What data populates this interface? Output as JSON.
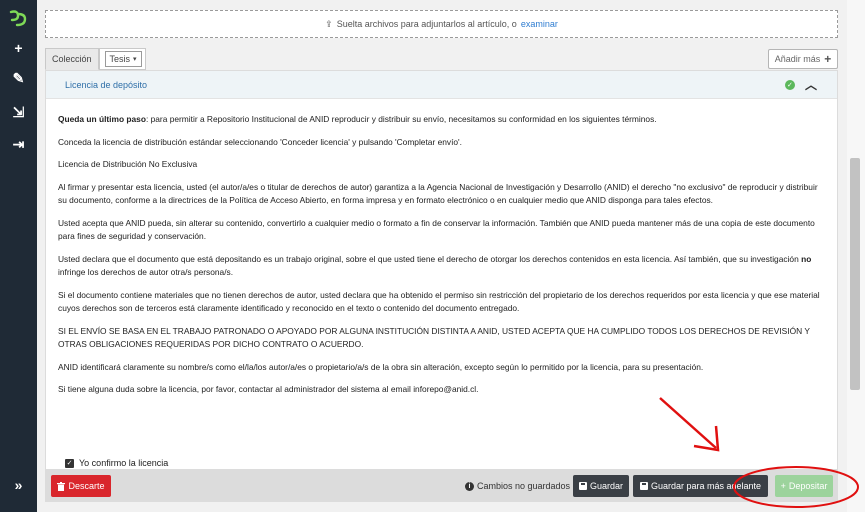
{
  "sidebar": {
    "logo": "dspace-logo",
    "items": [
      {
        "icon": "plus-icon",
        "glyph": "+"
      },
      {
        "icon": "pencil-icon",
        "glyph": "✎"
      },
      {
        "icon": "import-icon",
        "glyph": "⇲"
      },
      {
        "icon": "export-icon",
        "glyph": "⇥"
      }
    ],
    "expand_glyph": "»"
  },
  "dropzone": {
    "text": "Suelta archivos para adjuntarlos al artículo, o",
    "browse": "examinar",
    "upload_glyph": "⇪"
  },
  "tabs": {
    "collection_label": "Colección",
    "type_value": "Tesis",
    "caret": "▾"
  },
  "add_more": {
    "label": "Añadir más",
    "plus": "+"
  },
  "panel": {
    "title": "Licencia de depósito",
    "check_glyph": "✓",
    "chevron": "︿"
  },
  "license": {
    "p1_bold": "Queda un último paso",
    "p1_rest": ": para permitir a Repositorio Institucional de ANID reproducir y distribuir su envío, necesitamos su conformidad en los siguientes términos.",
    "p2": "Conceda la licencia de distribución estándar seleccionando 'Conceder licencia' y pulsando 'Completar envío'.",
    "p3": "Licencia de Distribución No Exclusiva",
    "p4": "Al firmar y presentar esta licencia, usted (el autor/a/es o titular de derechos de autor) garantiza a la Agencia Nacional de Investigación y Desarrollo (ANID) el derecho \"no exclusivo\" de reproducir y distribuir su documento, conforme a la directrices de la Política de Acceso Abierto, en forma impresa y en formato electrónico o en cualquier medio que ANID disponga para tales efectos.",
    "p5": "Usted acepta que ANID pueda, sin alterar su contenido, convertirlo a cualquier medio o formato a fin de conservar la información. También que ANID pueda mantener más de una copia de este documento para fines de seguridad y conservación.",
    "p6_a": "Usted declara que el documento que está depositando es un trabajo original, sobre el que usted tiene el derecho de otorgar los derechos contenidos en esta licencia. Así también, que su investigación ",
    "p6_bold": "no",
    "p6_b": " infringe los derechos de autor otra/s persona/s.",
    "p7": "Si el documento contiene materiales que no tienen derechos de autor, usted declara que ha obtenido el permiso sin restricción del propietario de los derechos requeridos por esta licencia y que ese material cuyos derechos son de terceros está claramente identificado y reconocido en el texto o contenido del documento entregado.",
    "p8": "SI EL ENVÍO SE BASA EN EL TRABAJO PATRONADO O APOYADO POR ALGUNA INSTITUCIÓN DISTINTA A ANID, USTED ACEPTA QUE HA CUMPLIDO TODOS LOS DERECHOS DE REVISIÓN Y OTRAS OBLIGACIONES REQUERIDAS POR DICHO CONTRATO O ACUERDO.",
    "p9": "ANID identificará claramente su nombre/s como el/la/los autor/a/es o propietario/a/s de la obra sin alteración, excepto según lo permitido por la licencia, para su presentación.",
    "p10": "Si tiene alguna duda sobre la licencia, por favor, contactar al administrador del sistema al email inforepo@anid.cl."
  },
  "confirm": {
    "label": "Yo confirmo la licencia",
    "checked": true,
    "check_glyph": "✓"
  },
  "footer": {
    "discard_label": "Descarte",
    "discard_icon": "trash-icon",
    "unsaved_text": "Cambios no guardados",
    "info_glyph": "i",
    "save_label": "Guardar",
    "save_later_label": "Guardar para más adelante",
    "deposit_label": "Depositar",
    "deposit_plus": "+"
  },
  "colors": {
    "sidebar": "#1f2a36",
    "danger": "#d9262c",
    "dark_button": "#3a3f45",
    "deposit_disabled": "#9cd39c",
    "annotation_red": "#e01010",
    "link": "#2f7dd1",
    "success": "#5cb85c"
  }
}
